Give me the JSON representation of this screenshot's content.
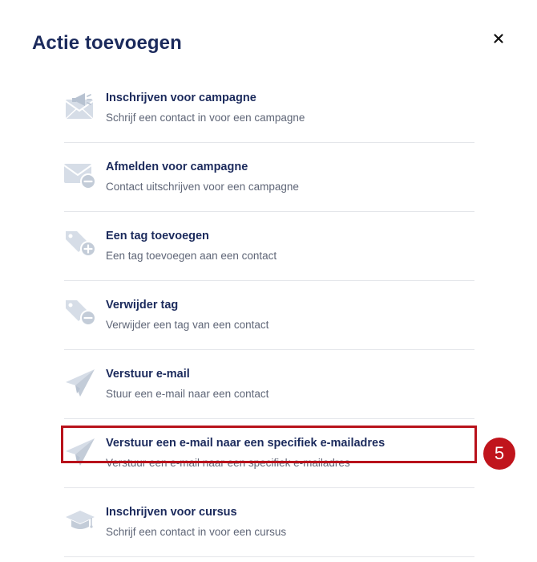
{
  "dialog": {
    "title": "Actie toevoegen",
    "close_label": "×"
  },
  "actions": [
    {
      "label": "Inschrijven voor campagne",
      "description": "Schrijf een contact in voor een campagne",
      "icon": "campaign-subscribe-icon"
    },
    {
      "label": "Afmelden voor campagne",
      "description": "Contact uitschrijven voor een campagne",
      "icon": "campaign-unsubscribe-icon"
    },
    {
      "label": "Een tag toevoegen",
      "description": "Een tag toevoegen aan een contact",
      "icon": "tag-add-icon"
    },
    {
      "label": "Verwijder tag",
      "description": "Verwijder een tag van een contact",
      "icon": "tag-remove-icon"
    },
    {
      "label": "Verstuur e-mail",
      "description": "Stuur een e-mail naar een contact",
      "icon": "paper-plane-icon"
    },
    {
      "label": "Verstuur een e-mail naar een specifiek e-mailadres",
      "description": "Verstuur een e-mail naar een specifiek e-mailadres",
      "icon": "paper-plane-icon"
    },
    {
      "label": "Inschrijven voor cursus",
      "description": "Schrijf een contact in voor een cursus",
      "icon": "graduation-cap-icon"
    }
  ],
  "annotation": {
    "badge_number": "5",
    "highlighted_item": "Verstuur een e-mail naar een specifiek e-mailadres",
    "color": "#c0141c"
  },
  "colors": {
    "title": "#1b2a5c",
    "description": "#5f6677",
    "icon": "#c3ccd8"
  }
}
